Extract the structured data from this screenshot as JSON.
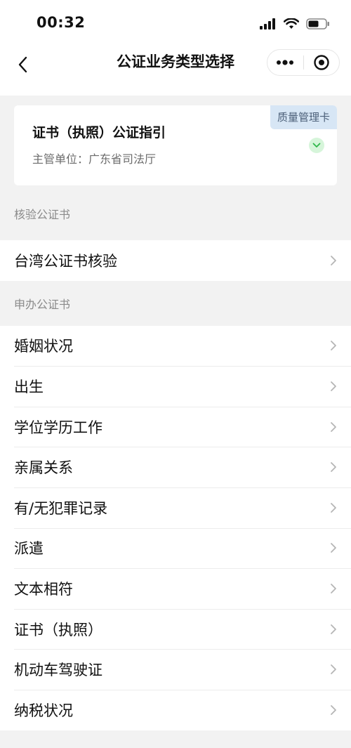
{
  "status_bar": {
    "time": "00:32"
  },
  "nav": {
    "title": "公证业务类型选择"
  },
  "guide_card": {
    "title": "证书（执照）公证指引",
    "subtitle": "主管单位：广东省司法厅",
    "badge": "质量管理卡"
  },
  "sections": [
    {
      "header": "核验公证书",
      "items": [
        {
          "label": "台湾公证书核验"
        }
      ]
    },
    {
      "header": "申办公证书",
      "items": [
        {
          "label": "婚姻状况"
        },
        {
          "label": "出生"
        },
        {
          "label": "学位学历工作"
        },
        {
          "label": "亲属关系"
        },
        {
          "label": "有/无犯罪记录"
        },
        {
          "label": "派遣"
        },
        {
          "label": "文本相符"
        },
        {
          "label": "证书（执照）"
        },
        {
          "label": "机动车驾驶证"
        },
        {
          "label": "纳税状况"
        }
      ]
    }
  ],
  "colors": {
    "accent_green": "#2fb84a",
    "badge_bg": "#d7e6f5",
    "page_bg": "#f2f2f2"
  }
}
